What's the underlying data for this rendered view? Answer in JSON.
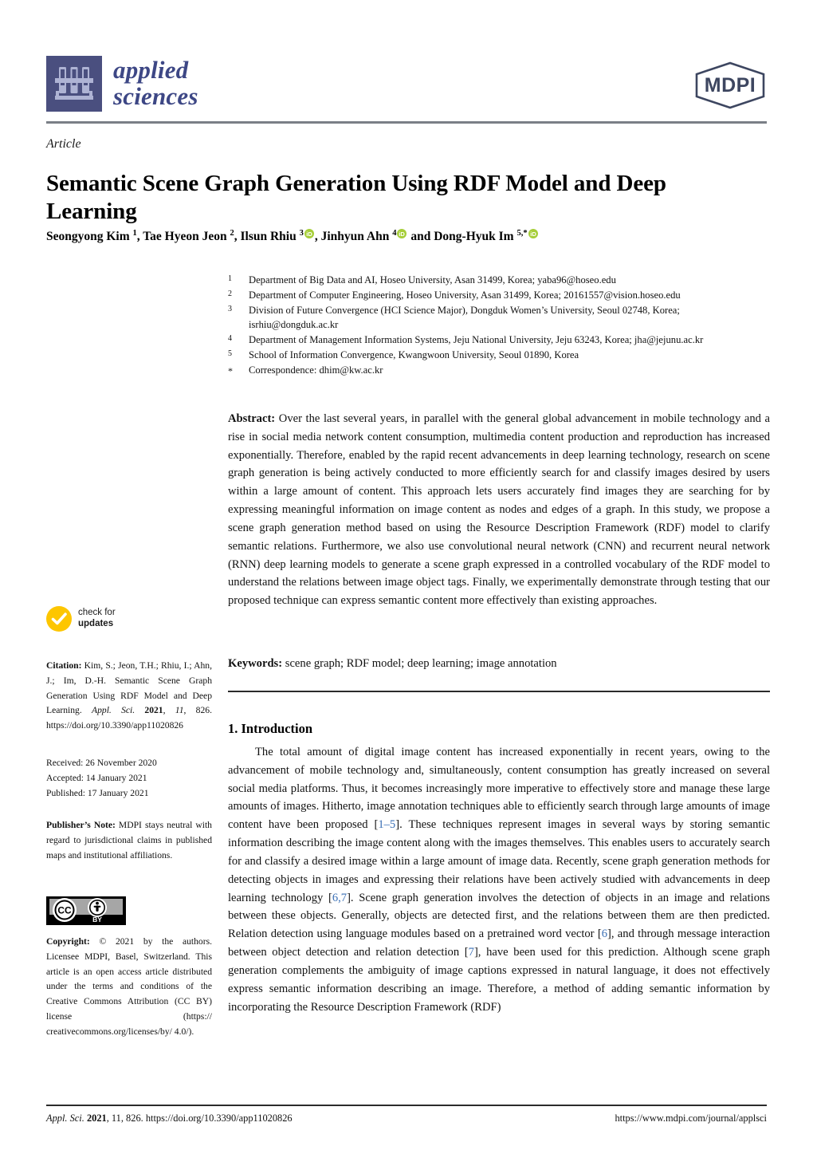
{
  "journal": {
    "name_line1": "applied",
    "name_line2": "sciences",
    "logo_icon": "test-tube-rack-icon",
    "publisher_logo_text": "MDPI",
    "brand_color": "#3d4785",
    "logo_bg_color": "#4a4f7f"
  },
  "article": {
    "type": "Article",
    "title": "Semantic Scene Graph Generation Using RDF Model and Deep Learning",
    "authors_html": "Seongyong Kim <sup>1</sup>, Tae Hyeon Jeon <sup>2</sup>, Ilsun Rhiu <sup>3</sup>ORCID, Jinhyun Ahn <sup>4</sup>ORCID and Dong-Hyuk Im <sup>5</sup>,<sup>*</sup>ORCID",
    "authors_plain": "Seongyong Kim 1, Tae Hyeon Jeon 2, Ilsun Rhiu 3, Jinhyun Ahn 4 and Dong-Hyuk Im 5,*"
  },
  "affiliations": [
    {
      "marker": "1",
      "text": "Department of Big Data and AI, Hoseo University, Asan 31499, Korea; yaba96@hoseo.edu"
    },
    {
      "marker": "2",
      "text": "Department of Computer Engineering, Hoseo University, Asan 31499, Korea; 20161557@vision.hoseo.edu"
    },
    {
      "marker": "3",
      "text": "Division of Future Convergence (HCI Science Major), Dongduk Women’s University, Seoul 02748, Korea; isrhiu@dongduk.ac.kr"
    },
    {
      "marker": "4",
      "text": "Department of Management Information Systems, Jeju National University, Jeju 63243, Korea; jha@jejunu.ac.kr"
    },
    {
      "marker": "5",
      "text": "School of Information Convergence, Kwangwoon University, Seoul 01890, Korea"
    },
    {
      "marker": "*",
      "text": "Correspondence: dhim@kw.ac.kr"
    }
  ],
  "abstract": {
    "label": "Abstract:",
    "text": "Over the last several years, in parallel with the general global advancement in mobile technology and a rise in social media network content consumption, multimedia content production and reproduction has increased exponentially. Therefore, enabled by the rapid recent advancements in deep learning technology, research on scene graph generation is being actively conducted to more efficiently search for and classify images desired by users within a large amount of content. This approach lets users accurately find images they are searching for by expressing meaningful information on image content as nodes and edges of a graph. In this study, we propose a scene graph generation method based on using the Resource Description Framework (RDF) model to clarify semantic relations. Furthermore, we also use convolutional neural network (CNN) and recurrent neural network (RNN) deep learning models to generate a scene graph expressed in a controlled vocabulary of the RDF model to understand the relations between image object tags. Finally, we experimentally demonstrate through testing that our proposed technique can express semantic content more effectively than existing approaches."
  },
  "keywords": {
    "label": "Keywords:",
    "text": "scene graph; RDF model; deep learning; image annotation"
  },
  "section": {
    "heading": "1. Introduction",
    "paragraph_part1": "The total amount of digital image content has increased exponentially in recent years, owing to the advancement of mobile technology and, simultaneously, content consumption has greatly increased on several social media platforms. Thus, it becomes increasingly more imperative to effectively store and manage these large amounts of images. Hitherto, image annotation techniques able to efficiently search through large amounts of image content have been proposed [",
    "ref1": "1–5",
    "paragraph_part2": "]. These techniques represent images in several ways by storing semantic information describing the image content along with the images themselves. This enables users to accurately search for and classify a desired image within a large amount of image data. Recently, scene graph generation methods for detecting objects in images and expressing their relations have been actively studied with advancements in deep learning technology [",
    "ref2": "6,7",
    "paragraph_part3": "]. Scene graph generation involves the detection of objects in an image and relations between these objects. Generally, objects are detected first, and the relations between them are then predicted. Relation detection using language modules based on a pretrained word vector [",
    "ref3": "6",
    "paragraph_part4": "], and through message interaction between object detection and relation detection [",
    "ref4": "7",
    "paragraph_part5": "], have been used for this prediction. Although scene graph generation complements the ambiguity of image captions expressed in natural language, it does not effectively express semantic information describing an image. Therefore, a method of adding semantic information by incorporating the Resource Description Framework (RDF)",
    "ref_color": "#3a6fb5"
  },
  "sidebar": {
    "check_updates": {
      "icon": "check-circle-icon",
      "line1": "check for",
      "line2": "updates",
      "color": "#fdc600"
    },
    "citation": {
      "label": "Citation:",
      "text_a": "Kim, S.; Jeon, T.H.; Rhiu, I.; Ahn, J.; Im, D.-H. Semantic Scene Graph Generation Using RDF Model and Deep Learning.",
      "journal_abbrev": "Appl. Sci.",
      "year": "2021",
      "volume": "11",
      "article_number": "826",
      "doi": "https://doi.org/10.3390/app11020826"
    },
    "dates": [
      "Received: 26 November 2020",
      "Accepted: 14 January 2021",
      "Published: 17 January 2021"
    ],
    "publisher_note": {
      "label": "Publisher’s Note:",
      "text": "MDPI stays neutral with regard to jurisdictional claims in published maps and institutional affiliations."
    },
    "cc_license": {
      "icon": "cc-by-icon",
      "cc_label": "CC",
      "by_label": "BY"
    },
    "copyright": {
      "label": "Copyright:",
      "text": "© 2021 by the authors. Licensee MDPI, Basel, Switzerland. This article is an open access article distributed under the terms and conditions of the Creative Commons Attribution (CC BY) license (https:// creativecommons.org/licenses/by/ 4.0/)."
    }
  },
  "footer": {
    "left_journal": "Appl. Sci.",
    "left_year": "2021",
    "left_rest": ", 11, 826. https://doi.org/10.3390/app11020826",
    "right": "https://www.mdpi.com/journal/applsci"
  }
}
